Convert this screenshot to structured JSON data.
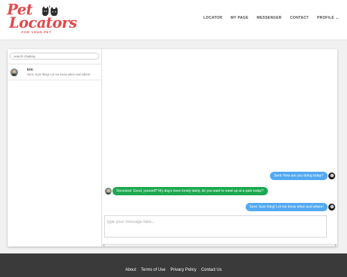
{
  "brand": {
    "name_line1": "Pet",
    "name_line2": "Locators",
    "tagline": "FOR YOUR PET",
    "color": "#e5474b",
    "logo_icon": "dog-and-cat-icon"
  },
  "nav": {
    "items": [
      "LOCATOR",
      "MY PAGE",
      "MESSENGER",
      "CONTACT",
      "PROFILE"
    ],
    "caret": "⌄"
  },
  "sidebar": {
    "search_placeholder": "search chatting",
    "conversations": [
      {
        "name": "kric",
        "preview": "Sent: Sure thing! Let me know when and where!"
      }
    ]
  },
  "thread": {
    "messages": [
      {
        "direction": "sent",
        "text": "Sent: How are you doing today?"
      },
      {
        "direction": "received",
        "text": "Received: Good, yourself? My dog's been lonely lately, do you want to meet up at a park today?"
      },
      {
        "direction": "sent",
        "text": "Sent: Sure thing! Let me know when and where!"
      }
    ],
    "compose_placeholder": "type your message here...",
    "sent_color": "#53a9f2",
    "received_color": "#1ca850"
  },
  "footer": {
    "links": [
      "About",
      "Terms of Use",
      "Privacy Policy",
      "Contact Us"
    ]
  }
}
